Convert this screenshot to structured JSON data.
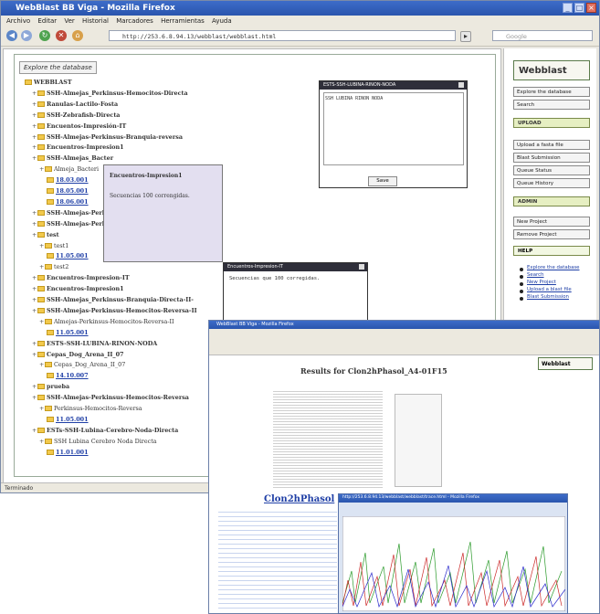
{
  "browser": {
    "title": "WebBlast BB Viga - Mozilla Firefox",
    "menu": [
      "Archivo",
      "Editar",
      "Ver",
      "Historial",
      "Marcadores",
      "Herramientas",
      "Ayuda"
    ],
    "url": "http://253.6.8.94.13/webblast/webblast.html",
    "search_placeholder": "Google",
    "status": "Terminado"
  },
  "explore": {
    "legend": "Explore the database"
  },
  "tree": [
    {
      "label": "WEBBLAST",
      "level": 0,
      "style": "root"
    },
    {
      "label": "SSH-Almejas_Perkinsus-Hemocitos-Directa",
      "level": 1,
      "style": "folder"
    },
    {
      "label": "Ranulas-Lactilo-Fosta",
      "level": 1,
      "style": "folder"
    },
    {
      "label": "SSH-Zebrafish-Directa",
      "level": 1,
      "style": "folder"
    },
    {
      "label": "Encuentos-Impresión-IT",
      "level": 1,
      "style": "folder"
    },
    {
      "label": "SSH-Almejas-Perkinsus-Branquia-reversa",
      "level": 1,
      "style": "folder"
    },
    {
      "label": "Encuentros-Impresion1",
      "level": 1,
      "style": "folder"
    },
    {
      "label": "SSH-Almejas_Bacter",
      "level": 1,
      "style": "folder"
    },
    {
      "label": "Almeja_Bacteri",
      "level": 2,
      "style": "folder"
    },
    {
      "label": "18.03.001",
      "level": 3,
      "style": "link"
    },
    {
      "label": "18.05.001",
      "level": 3,
      "style": "link"
    },
    {
      "label": "18.06.001",
      "level": 3,
      "style": "link"
    },
    {
      "label": "SSH-Almejas-Perkin",
      "level": 1,
      "style": "folder"
    },
    {
      "label": "SSH-Almejas-Perkin",
      "level": 1,
      "style": "folder"
    },
    {
      "label": "test",
      "level": 1,
      "style": "folder"
    },
    {
      "label": "test1",
      "level": 2,
      "style": "folder"
    },
    {
      "label": "11.05.001",
      "level": 3,
      "style": "link"
    },
    {
      "label": "test2",
      "level": 2,
      "style": "folder"
    },
    {
      "label": "Encuentros-Impresion-IT",
      "level": 1,
      "style": "folder"
    },
    {
      "label": "Encuentros-Impresion1",
      "level": 1,
      "style": "folder"
    },
    {
      "label": "SSH-Almejas_Perkinsus-Branquia-Directa-II-",
      "level": 1,
      "style": "folder"
    },
    {
      "label": "SSH-Almejas-Perkinsus-Hemocitos-Reversa-II",
      "level": 1,
      "style": "folder"
    },
    {
      "label": "Almejas-Perkinsus-Hemocitos-Reversa-II",
      "level": 2,
      "style": "folder"
    },
    {
      "label": "11.05.001",
      "level": 3,
      "style": "link"
    },
    {
      "label": "ESTS-SSH-LUBINA-RINON-NODA",
      "level": 1,
      "style": "folder"
    },
    {
      "label": "Cepas_Dog_Arena_II_07",
      "level": 1,
      "style": "folder"
    },
    {
      "label": "Cepas_Dog_Arena_II_07",
      "level": 2,
      "style": "folder"
    },
    {
      "label": "14.10.007",
      "level": 3,
      "style": "link"
    },
    {
      "label": "prueba",
      "level": 1,
      "style": "folder"
    },
    {
      "label": "SSH-Almejas-Perkinsus-Hemocitos-Reversa",
      "level": 1,
      "style": "folder"
    },
    {
      "label": "Perkinsus-Hemocitos-Reversa",
      "level": 2,
      "style": "folder"
    },
    {
      "label": "11.05.001",
      "level": 3,
      "style": "link"
    },
    {
      "label": "ESTs-SSH-Lubina-Cerebro-Noda-Directa",
      "level": 1,
      "style": "folder"
    },
    {
      "label": "SSH Lubina Cerebro Noda Directa",
      "level": 2,
      "style": "folder"
    },
    {
      "label": "11.01.001",
      "level": 3,
      "style": "link"
    }
  ],
  "sidebar": {
    "title": "Webblast",
    "buttons_top": [
      "Explore the database",
      "Search"
    ],
    "section_upload": "UPLOAD",
    "buttons_upload": [
      "Upload a fasta file",
      "Blast Submission",
      "Queue Status",
      "Queue History"
    ],
    "section_admin": "ADMIN",
    "buttons_admin": [
      "New Project",
      "Remove Project"
    ],
    "section_help": "HELP",
    "help_links": [
      "Explore the database",
      "Search",
      "New Project",
      "Upload a blast file",
      "Blast Submission"
    ]
  },
  "popups": {
    "queue": {
      "title": "ESTS-SSH-LUBINA-RINON-NODA",
      "line": "SSH LUBINA RINON NODA",
      "button": "Save"
    },
    "seq_selected": {
      "title": "Encuentros-Impresion1",
      "text": "Secuencias 100 correngidas."
    },
    "impresion": {
      "title": "Encuentros-Impresion-IT",
      "text": "Secuencias que 100 corregidas."
    }
  },
  "nested": {
    "title_bar": "WebBlast BB Viga - Mozilla Firefox",
    "heading": "Results for Clon2hPhasol_A4-01F15",
    "blast_title": "Clon2hPhasol",
    "sidebar_title": "Webblast",
    "side_label": "Webblast"
  },
  "chrom": {
    "title": "http://253.6.8.94.13/webblast/webblast/trace.html - Mozilla Firefox"
  }
}
